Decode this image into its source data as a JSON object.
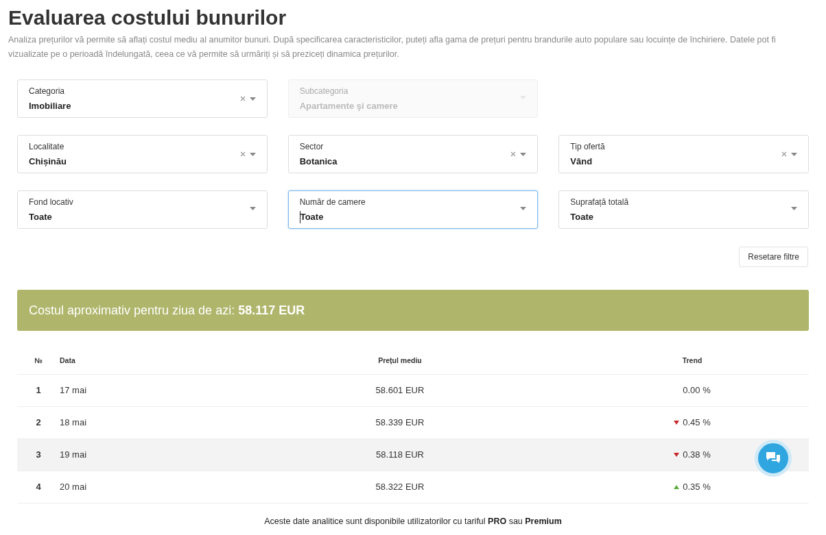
{
  "title": "Evaluarea costului bunurilor",
  "description": "Analiza prețurilor vă permite să aflați costul mediu al anumitor bunuri. După specificarea caracteristicilor, puteți afla gama de prețuri pentru brandurile auto populare sau locuințe de închiriere. Datele pot fi vizualizate pe o perioadă îndelungată, ceea ce vă permite să urmăriți și să preziceți dinamica prețurilor.",
  "filter_rows": [
    [
      {
        "label": "Categoria",
        "value": "Imobiliare",
        "clearable": true,
        "disabled": false,
        "focused": false
      },
      {
        "label": "Subcategoria",
        "value": "Apartamente şi camere",
        "clearable": false,
        "disabled": true,
        "focused": false
      }
    ],
    [
      {
        "label": "Localitate",
        "value": "Chișinău",
        "clearable": true,
        "disabled": false,
        "focused": false
      },
      {
        "label": "Sector",
        "value": "Botanica",
        "clearable": true,
        "disabled": false,
        "focused": false
      },
      {
        "label": "Tip ofertă",
        "value": "Vând",
        "clearable": true,
        "disabled": false,
        "focused": false
      }
    ],
    [
      {
        "label": "Fond locativ",
        "value": "Toate",
        "clearable": false,
        "disabled": false,
        "focused": false
      },
      {
        "label": "Număr de camere",
        "value": "Toate",
        "clearable": false,
        "disabled": false,
        "focused": true
      },
      {
        "label": "Suprafață totală",
        "value": "Toate",
        "clearable": false,
        "disabled": false,
        "focused": false
      }
    ]
  ],
  "reset_button": "Resetare filtre",
  "banner": "Costul aproximativ pentru ziua de azi: **58.117 EUR**",
  "table": {
    "columns": [
      "№",
      "Data",
      "Prețul mediu",
      "Trend"
    ],
    "rows": [
      {
        "no": "1",
        "date": "17 mai",
        "price": "58.601 EUR",
        "trend": "0.00 %",
        "kind": "flat",
        "selected": false
      },
      {
        "no": "2",
        "date": "18 mai",
        "price": "58.339 EUR",
        "trend": "0.45 %",
        "kind": "down",
        "selected": false
      },
      {
        "no": "3",
        "date": "19 mai",
        "price": "58.118 EUR",
        "trend": "0.38 %",
        "kind": "down",
        "selected": true
      },
      {
        "no": "4",
        "date": "20 mai",
        "price": "58.322 EUR",
        "trend": "0.35 %",
        "kind": "up",
        "selected": false
      }
    ]
  },
  "footer_note": "Aceste date analitice sunt disponibile utilizatorilor cu tariful **PRO** sau **Premium**"
}
